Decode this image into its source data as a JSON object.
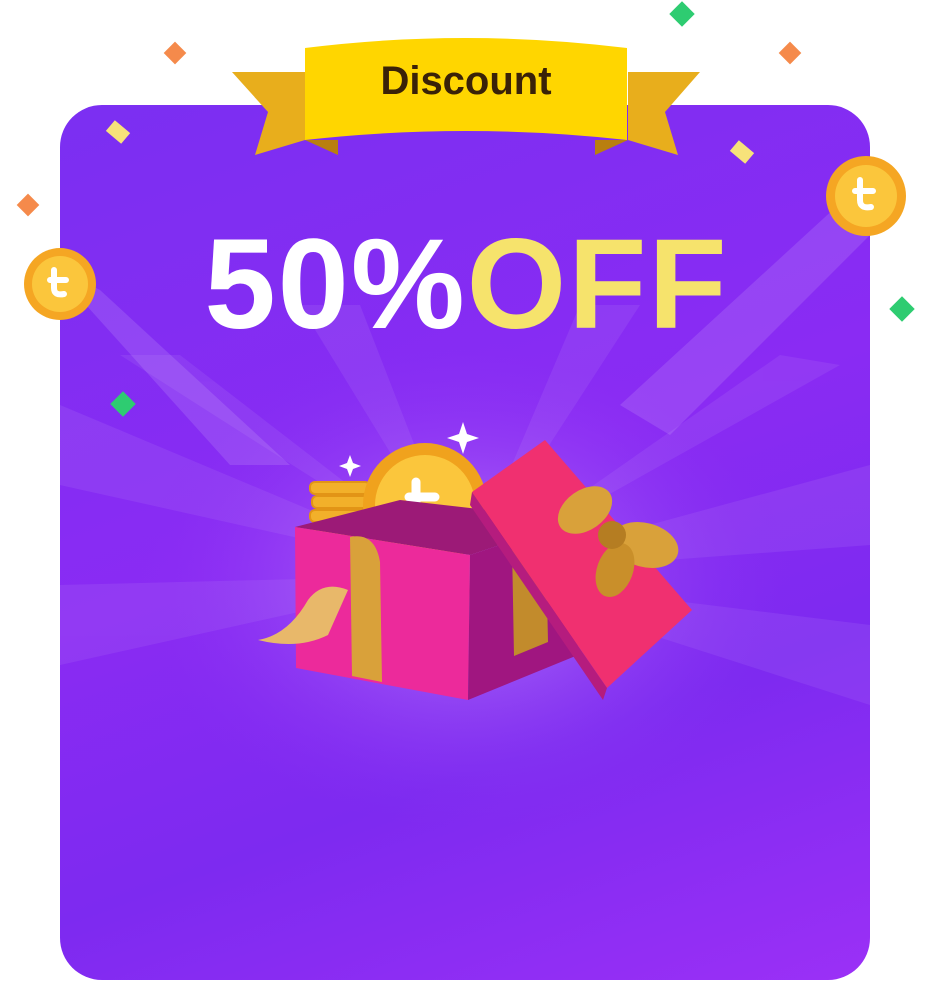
{
  "banner": {
    "label": "Discount"
  },
  "headline": {
    "percent": "50%",
    "off": "OFF"
  },
  "colors": {
    "card": "#8a2bf3",
    "ribbon": "#ffd600",
    "ribbon_shadow": "#e8ae1c",
    "headline_white": "#ffffff",
    "headline_yellow": "#f6e36c",
    "gift_box": "#f0288f",
    "coin": "#f5a623"
  },
  "icons": [
    "gift-box-icon",
    "coin-icon",
    "sparkle-icon",
    "confetti-icon",
    "ribbon-banner-icon"
  ]
}
